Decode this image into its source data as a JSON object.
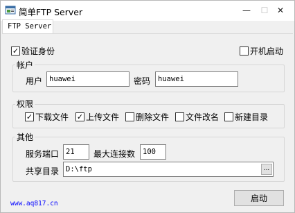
{
  "window": {
    "title": "简单FTP Server",
    "minimize_glyph": "—",
    "maximize_glyph": "☐",
    "close_glyph": "✕"
  },
  "tabs": [
    {
      "label": "FTP Server"
    }
  ],
  "options": {
    "verify_identity": {
      "label": "验证身份",
      "checked": true
    },
    "autostart": {
      "label": "开机启动",
      "checked": false
    }
  },
  "account": {
    "legend": "帐户",
    "user_label": "用户",
    "user_value": "huawei",
    "password_label": "密码",
    "password_value": "huawei"
  },
  "permissions": {
    "legend": "权限",
    "items": [
      {
        "label": "下载文件",
        "checked": true
      },
      {
        "label": "上传文件",
        "checked": true
      },
      {
        "label": "删除文件",
        "checked": false
      },
      {
        "label": "文件改名",
        "checked": false
      },
      {
        "label": "新建目录",
        "checked": false
      }
    ]
  },
  "other": {
    "legend": "其他",
    "port_label": "服务端口",
    "port_value": "21",
    "maxconn_label": "最大连接数",
    "maxconn_value": "100",
    "share_label": "共享目录",
    "share_value": "D:\\ftp",
    "browse_label": "..."
  },
  "footer": {
    "url": "www.aq817.cn",
    "start_label": "启动"
  }
}
